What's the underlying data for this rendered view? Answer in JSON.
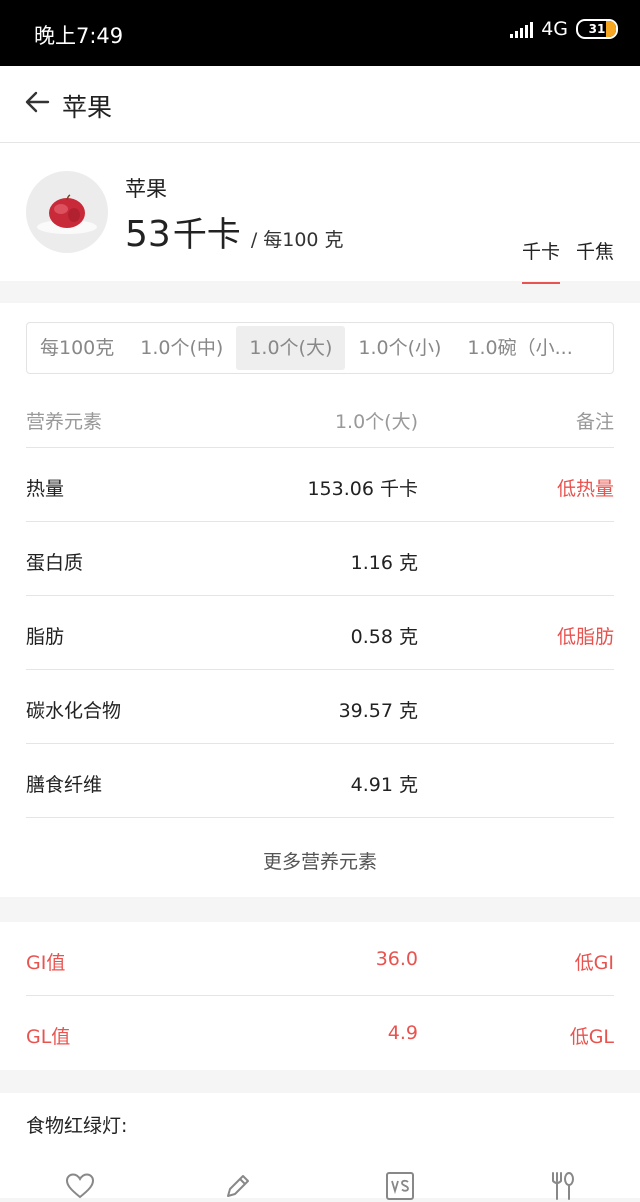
{
  "status": {
    "time": "晚上7:49",
    "network": "4G",
    "battery": "31"
  },
  "header": {
    "title": "苹果"
  },
  "summary": {
    "name": "苹果",
    "kcal_value": "53",
    "kcal_unit": "千卡",
    "per": "/ 每100 克",
    "units": [
      "千卡",
      "千焦"
    ]
  },
  "portions": [
    "每100克",
    "1.0个(中)",
    "1.0个(大)",
    "1.0个(小)",
    "1.0碗（小..."
  ],
  "table": {
    "headers": [
      "营养元素",
      "1.0个(大)",
      "备注"
    ],
    "rows": [
      {
        "name": "热量",
        "value": "153.06 千卡",
        "note": "低热量"
      },
      {
        "name": "蛋白质",
        "value": "1.16 克",
        "note": ""
      },
      {
        "name": "脂肪",
        "value": "0.58 克",
        "note": "低脂肪"
      },
      {
        "name": "碳水化合物",
        "value": "39.57 克",
        "note": ""
      },
      {
        "name": "膳食纤维",
        "value": "4.91 克",
        "note": ""
      }
    ],
    "more": "更多营养元素"
  },
  "gi": [
    {
      "name": "GI值",
      "value": "36.0",
      "note": "低GI"
    },
    {
      "name": "GL值",
      "value": "4.9",
      "note": "低GL"
    }
  ],
  "traffic": {
    "label": "食物红绿灯:"
  },
  "colors": {
    "accent": "#e8534f"
  },
  "bottom_icons": [
    "heart-icon",
    "pencil-icon",
    "vs-icon",
    "fork-spoon-icon"
  ]
}
